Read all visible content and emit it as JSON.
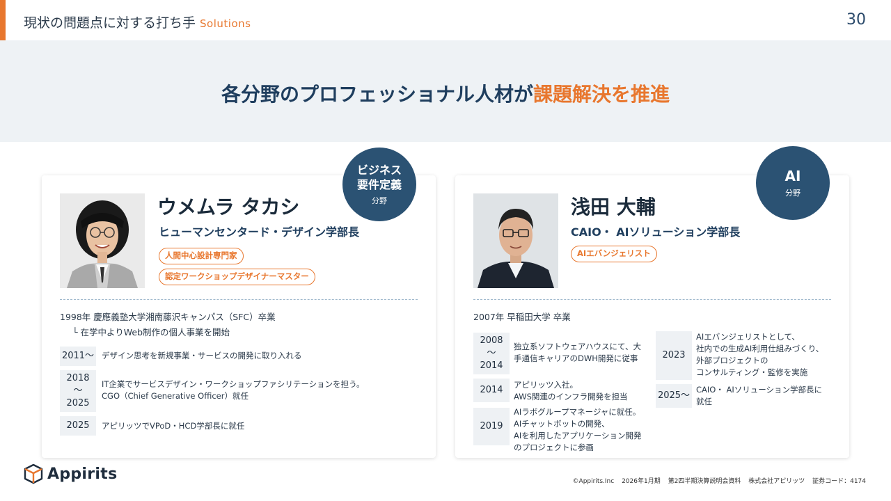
{
  "header": {
    "title": "現状の問題点に対する打ち手",
    "subtitle": "Solutions",
    "page_number": "30"
  },
  "headline": {
    "main": "各分野のプロフェッショナル人材が",
    "highlight": "課題解決を推進"
  },
  "left": {
    "badge": {
      "line1": "ビジネス",
      "line2": "要件定義",
      "sub": "分野"
    },
    "name": "ウメムラ タカシ",
    "role": "ヒューマンセンタード・デザイン学部長",
    "tags": [
      "人間中心設計専門家",
      "認定ワークショップデザイナーマスター"
    ],
    "education": "1998年 慶應義塾大学湘南藤沢キャンパス（SFC）卒業",
    "education_note": "└ 在学中よりWeb制作の個人事業を開始",
    "timeline": [
      {
        "year": "2011〜",
        "lines": [
          "デザイン思考を新規事業・サービスの開発に取り入れる"
        ]
      },
      {
        "year_top": "2018",
        "year_mid": "〜",
        "year_bottom": "2025",
        "lines": [
          "IT企業でサービスデザイン・ワークショップファシリテーションを担う。",
          "CGO（Chief Generative Officer）就任"
        ]
      },
      {
        "year": "2025",
        "lines": [
          "アピリッツでVPoD・HCD学部長に就任"
        ]
      }
    ]
  },
  "right": {
    "badge": {
      "line1": "AI",
      "sub": "分野"
    },
    "name": "浅田 大輔",
    "role": "CAIO・ AIソリューション学部長",
    "tags": [
      "AIエバンジェリスト"
    ],
    "education": "2007年 早稲田大学 卒業",
    "timeline_left": [
      {
        "year_top": "2008",
        "year_mid": "〜",
        "year_bottom": "2014",
        "lines": [
          "独立系ソフトウェアハウスにて、大",
          "手通信キャリアのDWH開発に従事"
        ]
      },
      {
        "year": "2014",
        "lines": [
          "アピリッツ入社。",
          "AWS関連のインフラ開発を担当"
        ]
      },
      {
        "year": "2019",
        "lines": [
          "AIラボグループマネージャに就任。",
          "AIチャットボットの開発、",
          "AIを利用したアプリケーション開発",
          "のプロジェクトに参画"
        ]
      }
    ],
    "timeline_right": [
      {
        "year": "2023",
        "lines": [
          "AIエバンジェリストとして、",
          "社内での生成AI利用仕組みづくり、",
          "外部プロジェクトの",
          "コンサルティング・監修を実施"
        ]
      },
      {
        "year": "2025〜",
        "lines": [
          "CAIO・ AIソリューション学部長に",
          "就任"
        ]
      }
    ]
  },
  "footer": {
    "logo": "Appirits",
    "copyright": "©Appirits.Inc",
    "period": "2026年1月期",
    "doc": "第2四半期決算説明会資料",
    "company": "株式会社アピリッツ",
    "code": "証券コード：4174"
  },
  "colors": {
    "accent": "#e8772e",
    "navy": "#2b5273",
    "band": "#eef2f5"
  }
}
